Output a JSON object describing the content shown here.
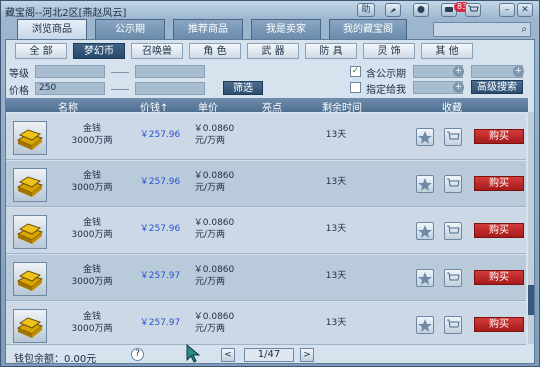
{
  "window": {
    "title": "藏宝阁--河北2区[燕赵风云]"
  },
  "toolbar": {
    "help_label": "助",
    "badge_count": "83"
  },
  "main_tabs": [
    {
      "label": "浏览商品",
      "active": true
    },
    {
      "label": "公示期",
      "active": false
    },
    {
      "label": "推荐商品",
      "active": false
    },
    {
      "label": "我是卖家",
      "active": false
    },
    {
      "label": "我的藏宝阁",
      "active": false
    }
  ],
  "categories": [
    {
      "label": "全 部",
      "active": false
    },
    {
      "label": "梦幻币",
      "active": true
    },
    {
      "label": "召唤兽",
      "active": false
    },
    {
      "label": "角 色",
      "active": false
    },
    {
      "label": "武 器",
      "active": false
    },
    {
      "label": "防 具",
      "active": false
    },
    {
      "label": "灵 饰",
      "active": false
    },
    {
      "label": "其 他",
      "active": false
    }
  ],
  "filters": {
    "level_label": "等级",
    "price_label": "价格",
    "price_value": "250",
    "filter_button": "筛选",
    "public_label": "含公示期",
    "assigned_label": "指定给我",
    "advanced_button": "高级搜索",
    "public_checked": true,
    "assigned_checked": false
  },
  "table": {
    "headers": {
      "name": "名称",
      "price": "价钱↑",
      "unit": "单价",
      "highlight": "亮点",
      "time": "剩余时间",
      "favorite": "收藏"
    },
    "rows": [
      {
        "name": "金钱",
        "amount": "3000万两",
        "price": "￥257.96",
        "unit_price": "￥0.0860",
        "unit_suffix": "元/万两",
        "time": "13天",
        "buy": "购买"
      },
      {
        "name": "金钱",
        "amount": "3000万两",
        "price": "￥257.96",
        "unit_price": "￥0.0860",
        "unit_suffix": "元/万两",
        "time": "13天",
        "buy": "购买"
      },
      {
        "name": "金钱",
        "amount": "3000万两",
        "price": "￥257.96",
        "unit_price": "￥0.0860",
        "unit_suffix": "元/万两",
        "time": "13天",
        "buy": "购买"
      },
      {
        "name": "金钱",
        "amount": "3000万两",
        "price": "￥257.97",
        "unit_price": "￥0.0860",
        "unit_suffix": "元/万两",
        "time": "13天",
        "buy": "购买"
      },
      {
        "name": "金钱",
        "amount": "3000万两",
        "price": "￥257.97",
        "unit_price": "￥0.0860",
        "unit_suffix": "元/万两",
        "time": "13天",
        "buy": "购买"
      }
    ]
  },
  "footer": {
    "wallet": "钱包余额：0.00元",
    "help": "?",
    "prev": "<",
    "next": ">",
    "page": "1/47"
  },
  "colors": {
    "price": "#2a54c9",
    "buy": "#c62a2a",
    "header": "#4f6f91"
  }
}
